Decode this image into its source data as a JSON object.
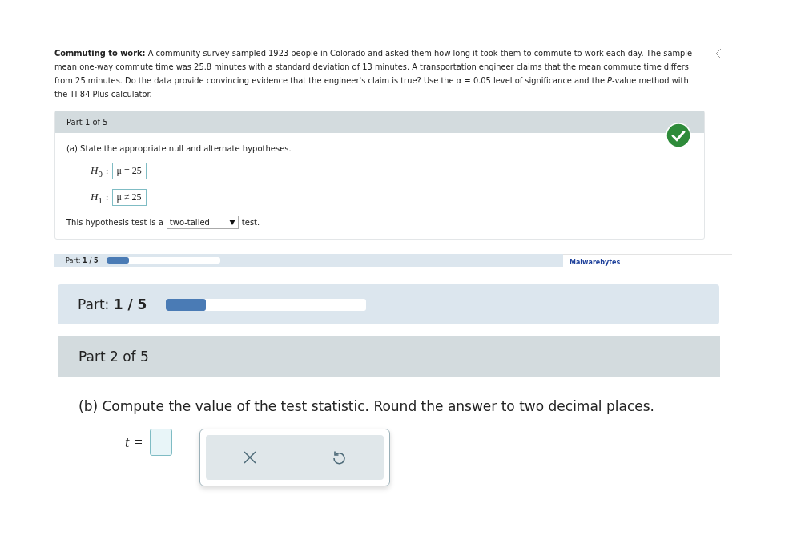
{
  "problem": {
    "text": "**Commuting to work:** A community survey sampled 1923 people in Colorado and asked them how long it took them to commute to work each day. The sample mean one-way commute time was 25.8 minutes with a standard deviation of 13 minutes. A transportation engineer claims that the mean commute time differs from 25 minutes. Do the data provide convincing evidence that the engineer's claim is true? Use the α = 0.05 level of significance and the *P*-value method with the TI-84 Plus calculator."
  },
  "part1": {
    "header": "Part 1 of 5",
    "complete": true,
    "prompt": "(a) State the appropriate null and alternate hypotheses.",
    "hypotheses": [
      {
        "label": "*H*$_{0}$",
        "sep": ":",
        "value": "μ = 25"
      },
      {
        "label": "*H*$_{1}$",
        "sep": ":",
        "value": "μ ≠ 25"
      }
    ],
    "test_before": "This hypothesis test is a",
    "test_select": "two-tailed",
    "test_after": "test."
  },
  "progress_strip": {
    "label": "Part:",
    "value": "1 / 5",
    "level": 0.2
  },
  "ad": {
    "text": "Malwarebytes"
  },
  "progress": {
    "label": "Part:",
    "value": "1 / 5",
    "level": 0.2
  },
  "part2": {
    "header": "Part 2 of 5",
    "prompt": "(b) Compute the value of the test statistic. Round the answer to two decimal places.",
    "answer_label": "t ="
  }
}
